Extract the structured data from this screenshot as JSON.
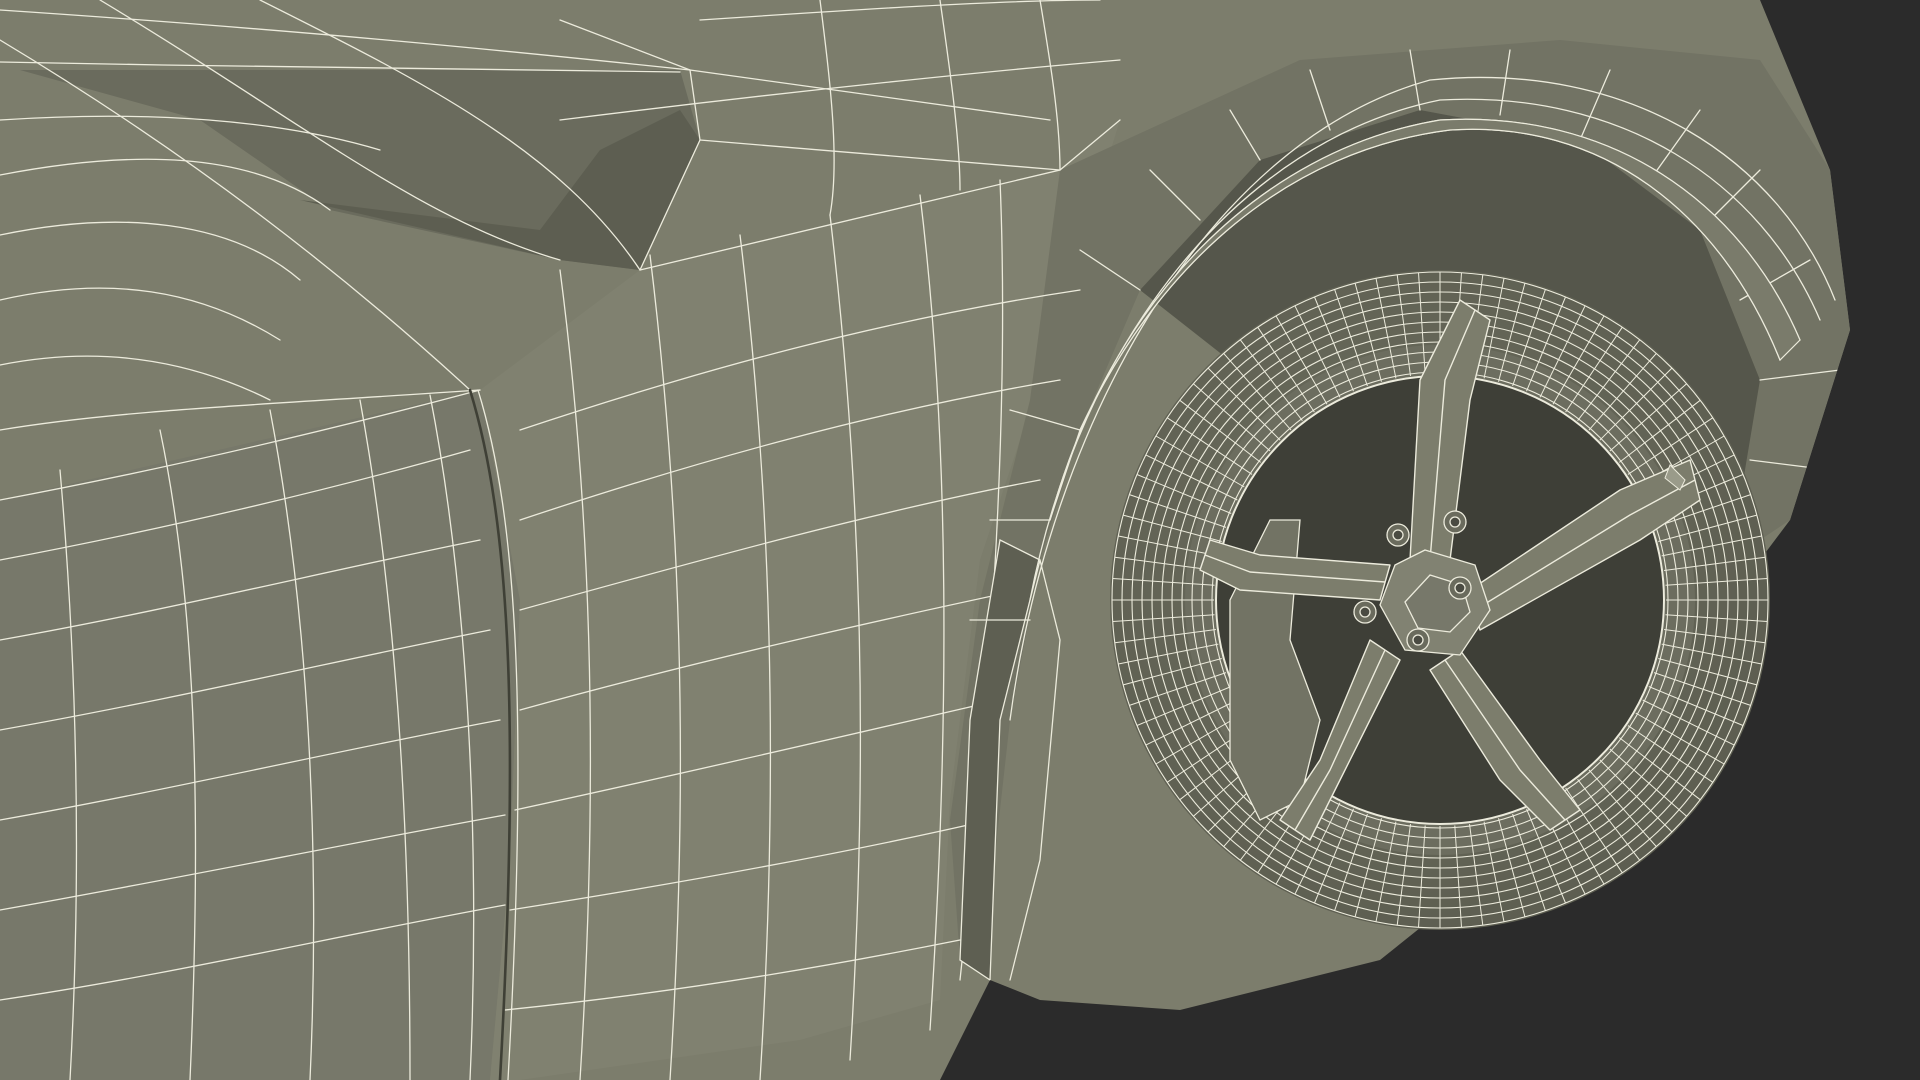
{
  "scene": {
    "subject": "wireframe-car-front-fender-and-wheel",
    "colors": {
      "background": "#2b2b2b",
      "surface": "#7c7d6c",
      "surface_dark": "#6e6f60",
      "surface_shadow": "#55564b",
      "cavity": "#3e3f37",
      "wire": "#ecebdc"
    }
  }
}
